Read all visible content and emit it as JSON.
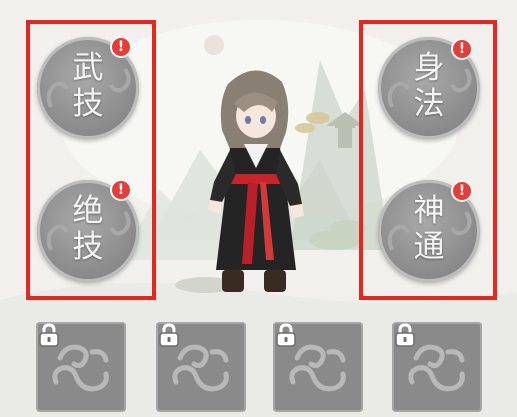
{
  "skills": {
    "wu_ji": {
      "char1": "武",
      "char2": "技",
      "alert": "!"
    },
    "jue_ji": {
      "char1": "绝",
      "char2": "技",
      "alert": "!"
    },
    "shen_fa": {
      "char1": "身",
      "char2": "法",
      "alert": "!"
    },
    "shen_tong": {
      "char1": "神",
      "char2": "通",
      "alert": "!"
    }
  },
  "slots": [
    {
      "status": "locked",
      "icon": "cloud-swirl-icon"
    },
    {
      "status": "locked",
      "icon": "cloud-swirl-icon"
    },
    {
      "status": "locked",
      "icon": "cloud-swirl-icon"
    },
    {
      "status": "locked",
      "icon": "cloud-swirl-icon"
    }
  ],
  "colors": {
    "highlight_box": "#e8261f",
    "alert_badge": "#e63d3a",
    "skill_disk": "#8d8d8d",
    "slot_bg": "#8a8a8a"
  }
}
